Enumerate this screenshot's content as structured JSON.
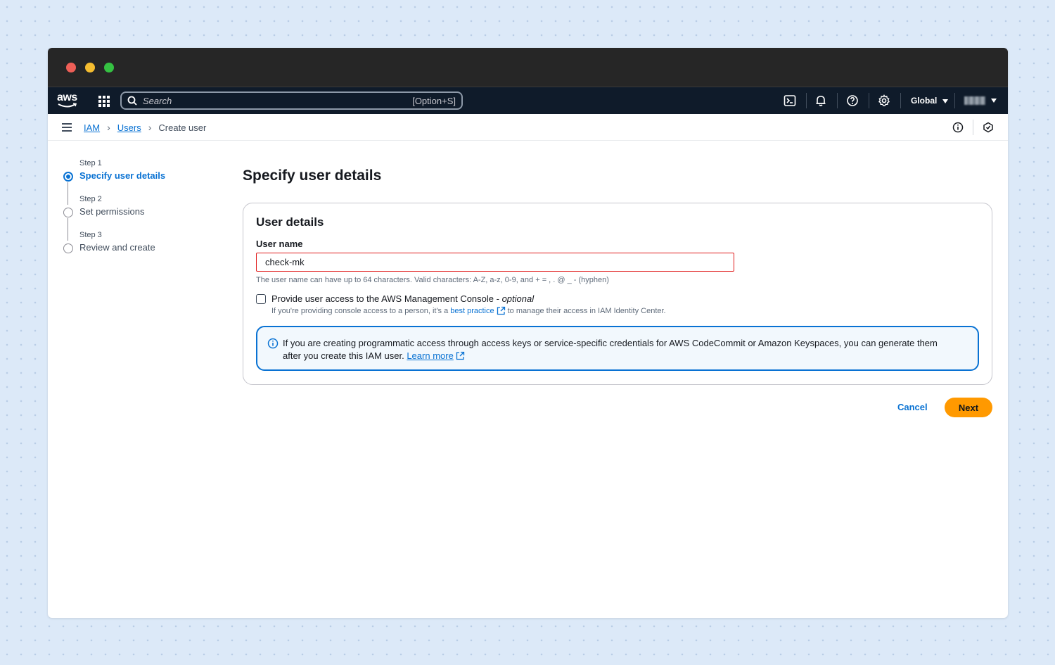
{
  "topnav": {
    "logo_text": "aws",
    "search_placeholder": "Search",
    "search_shortcut": "[Option+S]",
    "region": "Global",
    "icons": [
      "cloudshell-icon",
      "bell-icon",
      "help-icon",
      "gear-icon"
    ]
  },
  "breadcrumbs": {
    "items": [
      "IAM",
      "Users",
      "Create user"
    ]
  },
  "steps": [
    {
      "num": "Step 1",
      "title": "Specify user details",
      "active": true
    },
    {
      "num": "Step 2",
      "title": "Set permissions",
      "active": false
    },
    {
      "num": "Step 3",
      "title": "Review and create",
      "active": false
    }
  ],
  "page": {
    "title": "Specify user details"
  },
  "user_details": {
    "heading": "User details",
    "username_label": "User name",
    "username_value": "check-mk",
    "username_constraint": "The user name can have up to 64 characters. Valid characters: A-Z, a-z, 0-9, and + = , . @ _ - (hyphen)",
    "console_access_label": "Provide user access to the AWS Management Console -",
    "console_access_optional": "optional",
    "console_access_desc_pre": "If you're providing console access to a person, it's a",
    "console_access_desc_link": "best practice",
    "console_access_desc_post": "to manage their access in IAM Identity Center."
  },
  "info_alert": {
    "text": "If you are creating programmatic access through access keys or service-specific credentials for AWS CodeCommit or Amazon Keyspaces, you can generate them after you create this IAM user.",
    "link": "Learn more"
  },
  "actions": {
    "cancel": "Cancel",
    "next": "Next"
  },
  "colors": {
    "accent": "#0972d3",
    "primary_button": "#ff9900",
    "error_border": "#e01b1b",
    "topnav_bg": "#0f1b2a"
  }
}
